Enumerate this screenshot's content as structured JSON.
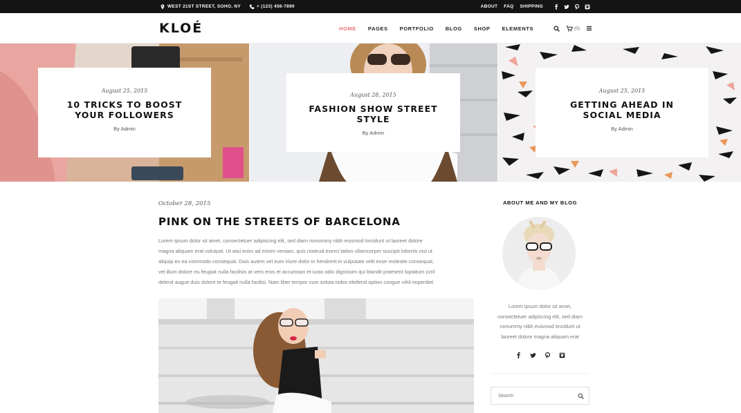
{
  "topbar": {
    "address": "WEST 21ST STREET, SOHO, NY",
    "phone": "+ (123) 456-7890",
    "links": [
      "ABOUT",
      "FAQ",
      "SHIPPING"
    ],
    "social_icons": [
      "facebook-icon",
      "twitter-icon",
      "pinterest-icon",
      "instagram-icon"
    ]
  },
  "header": {
    "logo": "KLOÉ",
    "nav": [
      "HOME",
      "PAGES",
      "PORTFOLIO",
      "BLOG",
      "SHOP",
      "ELEMENTS"
    ],
    "active_nav": "HOME",
    "cart_count": "(0)"
  },
  "featured": [
    {
      "date": "August 25, 2015",
      "title": "10 TRICKS TO BOOST YOUR FOLLOWERS",
      "by": "By Admin"
    },
    {
      "date": "August 28, 2015",
      "title": "FASHION SHOW STREET STYLE",
      "by": "By Admin"
    },
    {
      "date": "August 25, 2015",
      "title": "GETTING AHEAD IN SOCIAL MEDIA",
      "by": "By Admin"
    }
  ],
  "article": {
    "date": "October 28, 2015",
    "title": "PINK ON THE STREETS OF BARCELONA",
    "lines": [
      "Lorem ipsum dolor sit amet, consectetuer adipiscing elit, sed diam nonummy nibh euismod tincidunt ut laoreet dolore",
      "magna aliquam erat volutpat. Ut wisi enim ad minim veniam, quis nostrud exerci tation ullamcorper suscipit lobortis nisl ut",
      "aliquip ex ea commodo consequat. Duis autem vel eum iriure dolor in hendrerit in vulputate velit esse molestie consequat,",
      "vel illum dolore eu feugiat nulla facilisis at vero eros et accumsan et iusto odio dignissim qui blandit praesent luptatum zzril",
      "delenit augue duis dolore te feugait nulla facilisi. Nam liber tempor cum soluta nobis eleifend option congue nihil imperdiet"
    ]
  },
  "sidebar": {
    "title": "ABOUT ME AND MY BLOG",
    "lines": [
      "Lorem ipsum dolor sit amet,",
      "consectetuer adipiscing elit, sed diam",
      "nonummy nibh euismod tincidunt ut",
      "laoreet dolore magna aliquam erat"
    ],
    "social_icons": [
      "facebook-icon",
      "twitter-icon",
      "pinterest-icon",
      "instagram-icon"
    ],
    "search_placeholder": "Search"
  },
  "colors": {
    "accent": "#e8727a",
    "topbar_bg": "#141414"
  }
}
